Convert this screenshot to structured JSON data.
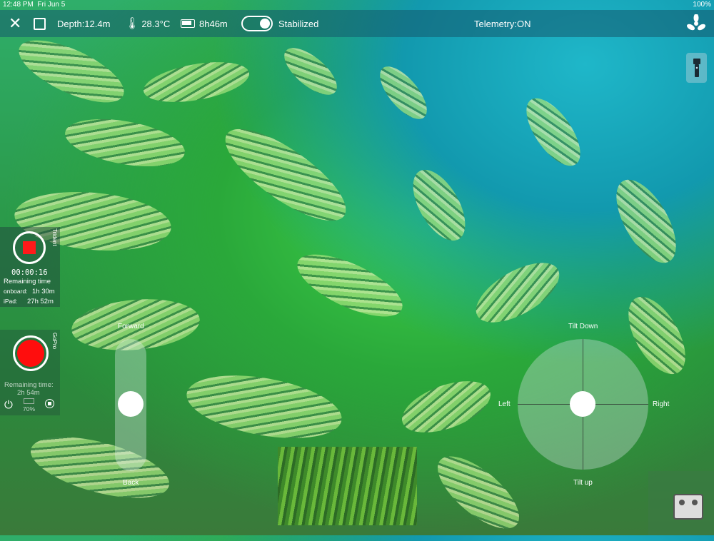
{
  "status_bar": {
    "time": "12:48 PM",
    "date": "Fri Jun 5",
    "battery": "100%"
  },
  "top_bar": {
    "depth": "Depth:12.4m",
    "temperature": "28.3°C",
    "runtime": "8h46m",
    "stabilized_label": "Stabilized",
    "stabilized_on": true,
    "telemetry": "Telemetry:ON"
  },
  "trident_panel": {
    "vertical_label": "Trident",
    "elapsed": "00:00:16",
    "remaining_label": "Remaining time",
    "onboard_label": "onboard:",
    "onboard_value": "1h 30m",
    "ipad_label": "iPad:",
    "ipad_value": "27h 52m"
  },
  "gopro_panel": {
    "vertical_label": "GoPro",
    "remaining_label": "Remaining time:",
    "remaining_value": "2h 54m",
    "battery_pct": "70%"
  },
  "throttle": {
    "forward_label": "Forward",
    "back_label": "Back"
  },
  "joystick": {
    "up_label": "Tilt Down",
    "down_label": "Tilt up",
    "left_label": "Left",
    "right_label": "Right"
  },
  "colors": {
    "record": "#ff0d0d",
    "overlay": "#145a6e"
  },
  "icons": [
    "close-icon",
    "square-icon",
    "thermometer-icon",
    "battery-icon",
    "propeller-icon",
    "flashlight-icon",
    "power-icon",
    "stop-icon"
  ]
}
